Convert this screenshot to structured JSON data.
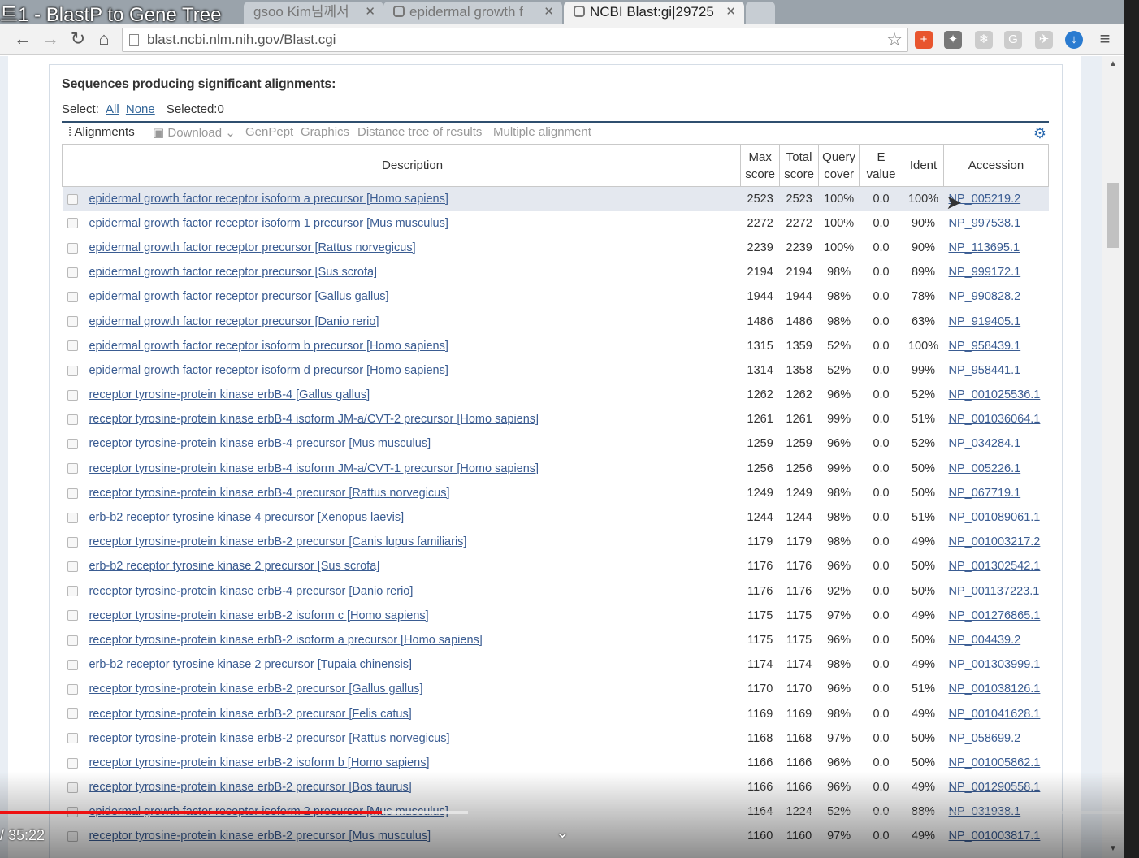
{
  "video": {
    "title": "트1 - BlastP to Gene Tree",
    "timecode": "/ 35:22"
  },
  "tabs": [
    {
      "label": "gsoo Kim님께서"
    },
    {
      "label": "epidermal growth f"
    },
    {
      "label": "NCBI Blast:gi|29725"
    }
  ],
  "address": {
    "url": "blast.ncbi.nlm.nih.gov/Blast.cgi"
  },
  "section": {
    "title": "Sequences producing significant alignments:",
    "select_label": "Select:",
    "all_label": "All",
    "none_label": "None",
    "selected_label": "Selected:0"
  },
  "tools": {
    "alignments": "Alignments",
    "download": "Download",
    "genpept": "GenPept",
    "graphics": "Graphics",
    "distance_tree": "Distance tree of results",
    "multiple_alignment": "Multiple alignment"
  },
  "table": {
    "headers": {
      "description": "Description",
      "max_score_1": "Max",
      "max_score_2": "score",
      "total_score_1": "Total",
      "total_score_2": "score",
      "query_cover_1": "Query",
      "query_cover_2": "cover",
      "evalue_1": "E",
      "evalue_2": "value",
      "ident": "Ident",
      "accession": "Accession"
    },
    "rows": [
      [
        "epidermal growth factor receptor isoform a precursor [Homo sapiens]",
        "2523",
        "2523",
        "100%",
        "0.0",
        "100%",
        "NP_005219.2"
      ],
      [
        "epidermal growth factor receptor isoform 1 precursor [Mus musculus]",
        "2272",
        "2272",
        "100%",
        "0.0",
        "90%",
        "NP_997538.1"
      ],
      [
        "epidermal growth factor receptor precursor [Rattus norvegicus]",
        "2239",
        "2239",
        "100%",
        "0.0",
        "90%",
        "NP_113695.1"
      ],
      [
        "epidermal growth factor receptor precursor [Sus scrofa]",
        "2194",
        "2194",
        "98%",
        "0.0",
        "89%",
        "NP_999172.1"
      ],
      [
        "epidermal growth factor receptor precursor [Gallus gallus]",
        "1944",
        "1944",
        "98%",
        "0.0",
        "78%",
        "NP_990828.2"
      ],
      [
        "epidermal growth factor receptor precursor [Danio rerio]",
        "1486",
        "1486",
        "98%",
        "0.0",
        "63%",
        "NP_919405.1"
      ],
      [
        "epidermal growth factor receptor isoform b precursor [Homo sapiens]",
        "1315",
        "1359",
        "52%",
        "0.0",
        "100%",
        "NP_958439.1"
      ],
      [
        "epidermal growth factor receptor isoform d precursor [Homo sapiens]",
        "1314",
        "1358",
        "52%",
        "0.0",
        "99%",
        "NP_958441.1"
      ],
      [
        "receptor tyrosine-protein kinase erbB-4 [Gallus gallus]",
        "1262",
        "1262",
        "96%",
        "0.0",
        "52%",
        "NP_001025536.1"
      ],
      [
        "receptor tyrosine-protein kinase erbB-4 isoform JM-a/CVT-2 precursor [Homo sapiens]",
        "1261",
        "1261",
        "99%",
        "0.0",
        "51%",
        "NP_001036064.1"
      ],
      [
        "receptor tyrosine-protein kinase erbB-4 precursor [Mus musculus]",
        "1259",
        "1259",
        "96%",
        "0.0",
        "52%",
        "NP_034284.1"
      ],
      [
        "receptor tyrosine-protein kinase erbB-4 isoform JM-a/CVT-1 precursor [Homo sapiens]",
        "1256",
        "1256",
        "99%",
        "0.0",
        "50%",
        "NP_005226.1"
      ],
      [
        "receptor tyrosine-protein kinase erbB-4 precursor [Rattus norvegicus]",
        "1249",
        "1249",
        "98%",
        "0.0",
        "50%",
        "NP_067719.1"
      ],
      [
        "erb-b2 receptor tyrosine kinase 4 precursor [Xenopus laevis]",
        "1244",
        "1244",
        "98%",
        "0.0",
        "51%",
        "NP_001089061.1"
      ],
      [
        "receptor tyrosine-protein kinase erbB-2 precursor [Canis lupus familiaris]",
        "1179",
        "1179",
        "98%",
        "0.0",
        "49%",
        "NP_001003217.2"
      ],
      [
        "erb-b2 receptor tyrosine kinase 2 precursor [Sus scrofa]",
        "1176",
        "1176",
        "96%",
        "0.0",
        "50%",
        "NP_001302542.1"
      ],
      [
        "receptor tyrosine-protein kinase erbB-4 precursor [Danio rerio]",
        "1176",
        "1176",
        "92%",
        "0.0",
        "50%",
        "NP_001137223.1"
      ],
      [
        "receptor tyrosine-protein kinase erbB-2 isoform c [Homo sapiens]",
        "1175",
        "1175",
        "97%",
        "0.0",
        "49%",
        "NP_001276865.1"
      ],
      [
        "receptor tyrosine-protein kinase erbB-2 isoform a precursor [Homo sapiens]",
        "1175",
        "1175",
        "96%",
        "0.0",
        "50%",
        "NP_004439.2"
      ],
      [
        "erb-b2 receptor tyrosine kinase 2 precursor [Tupaia chinensis]",
        "1174",
        "1174",
        "98%",
        "0.0",
        "49%",
        "NP_001303999.1"
      ],
      [
        "receptor tyrosine-protein kinase erbB-2 precursor [Gallus gallus]",
        "1170",
        "1170",
        "96%",
        "0.0",
        "51%",
        "NP_001038126.1"
      ],
      [
        "receptor tyrosine-protein kinase erbB-2 precursor [Felis catus]",
        "1169",
        "1169",
        "98%",
        "0.0",
        "49%",
        "NP_001041628.1"
      ],
      [
        "receptor tyrosine-protein kinase erbB-2 precursor [Rattus norvegicus]",
        "1168",
        "1168",
        "97%",
        "0.0",
        "50%",
        "NP_058699.2"
      ],
      [
        "receptor tyrosine-protein kinase erbB-2 isoform b [Homo sapiens]",
        "1166",
        "1166",
        "96%",
        "0.0",
        "50%",
        "NP_001005862.1"
      ],
      [
        "receptor tyrosine-protein kinase erbB-2 precursor [Bos taurus]",
        "1166",
        "1166",
        "96%",
        "0.0",
        "49%",
        "NP_001290558.1"
      ],
      [
        "epidermal growth factor receptor isoform 2 precursor [Mus musculus]",
        "1164",
        "1224",
        "52%",
        "0.0",
        "88%",
        "NP_031938.1"
      ],
      [
        "receptor tyrosine-protein kinase erbB-2 precursor [Mus musculus]",
        "1160",
        "1160",
        "97%",
        "0.0",
        "49%",
        "NP_001003817.1"
      ]
    ]
  },
  "colors": {
    "link": "#3a5c92",
    "highlight_row": "#e4e8ef",
    "progress": "#ee1111"
  }
}
